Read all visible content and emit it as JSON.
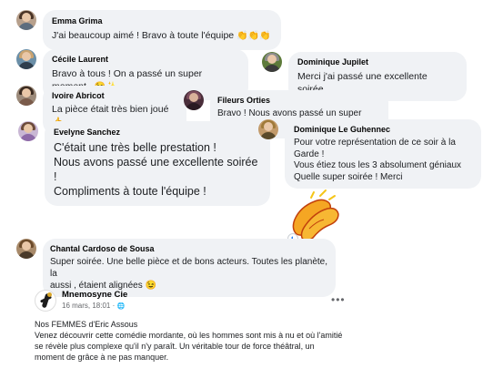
{
  "comments": [
    {
      "author": "Emma Grima",
      "text": "J'ai beaucoup aimé ! Bravo à toute l'équipe",
      "emoji": "👏👏👏"
    },
    {
      "author": "Cécile Laurent",
      "text": "Bravo à tous ! On a passé un super moment .",
      "emoji": "😉✨"
    },
    {
      "author": "Dominique Jupilet",
      "text": "Merci j'ai passé une excellente soirée."
    },
    {
      "author": "Ivoire Abricot",
      "text": "La pièce était très bien joué",
      "emoji": "👍"
    },
    {
      "author": "Fileurs Orties",
      "text": "Bravo ! Nous avons passé un super moment !"
    },
    {
      "author": "Evelyne Sanchez",
      "lines": [
        "C'était une très belle prestation !",
        "Nous avons passé une excellente soirée !",
        "Compliments à toute l'équipe !"
      ]
    },
    {
      "author": "Dominique Le Guhennec",
      "lines": [
        "Pour votre représentation de ce soir à la",
        "Garde !",
        "Vous étiez tous les 3 absolument géniaux",
        "Quelle super soirée ! Merci"
      ]
    },
    {
      "author": "Chantal Cardoso de Sousa",
      "lines": [
        "Super soirée. Une belle pièce et de bons acteurs. Toutes les planète, la",
        "aussi , étaient alignées"
      ],
      "emoji": "😉"
    }
  ],
  "post": {
    "name": "Mnemosyne Cie",
    "meta": "16 mars, 18:01 · ",
    "globe": "🌐",
    "title": "Nos FEMMES d'Eric Assous",
    "body": [
      "Venez découvrir cette comédie mordante, où les hommes sont mis à nu et où l'amitié",
      "se révèle plus complexe qu'il n'y paraît. Un véritable tour de force théâtral, un",
      "moment de grâce à ne pas manquer."
    ],
    "more": "•••"
  },
  "sticker_icon": "clapping-hands-sticker",
  "colors": {
    "bubble": "#f0f2f5",
    "text": "#050505",
    "meta": "#65676b"
  }
}
